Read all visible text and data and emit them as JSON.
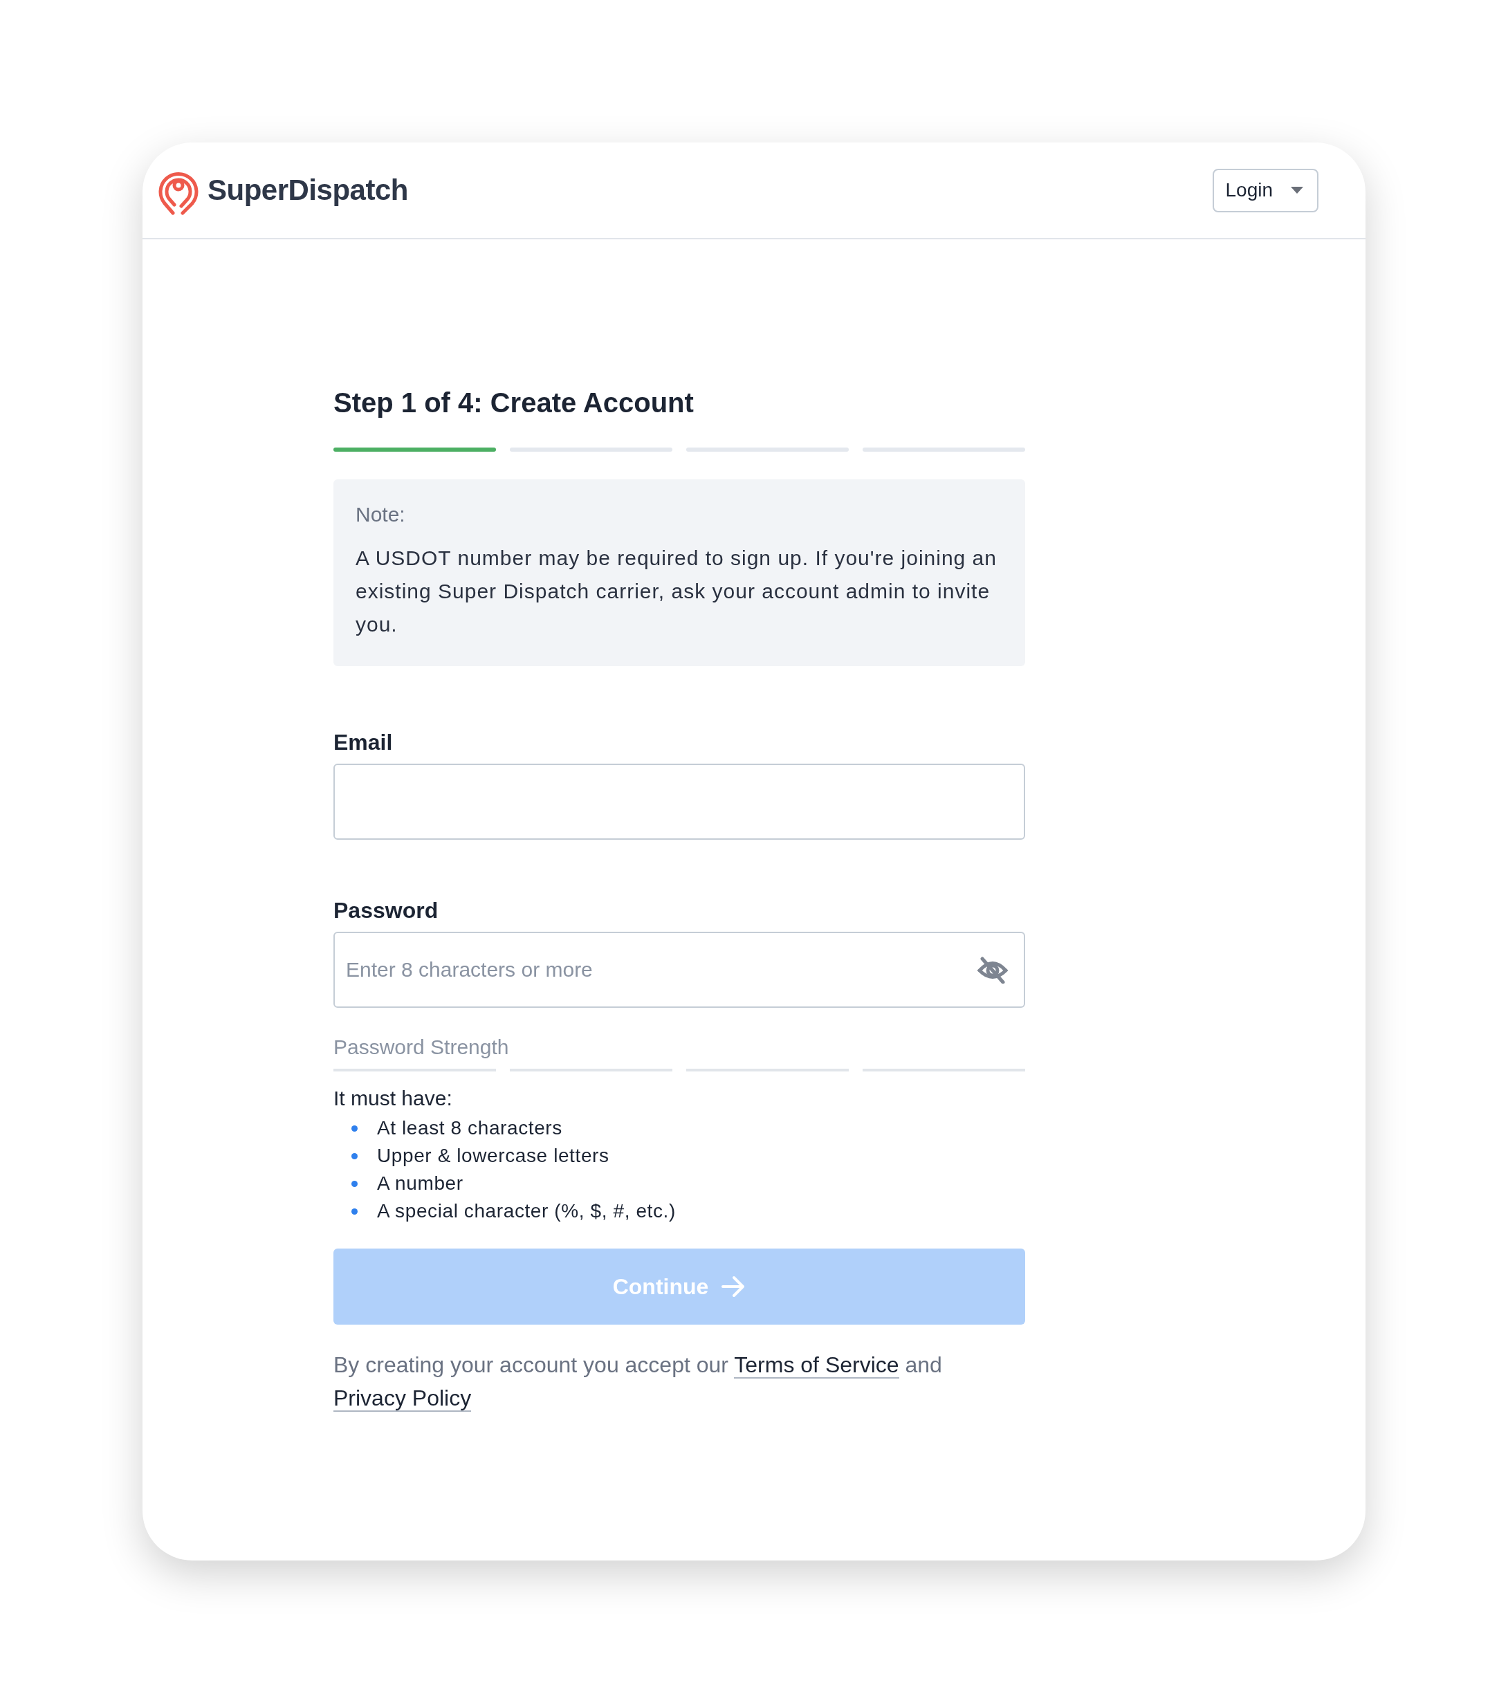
{
  "header": {
    "brand": "SuperDispatch",
    "login_button": "Login"
  },
  "title": "Step 1 of 4: Create Account",
  "steps": [
    {
      "done": true
    },
    {
      "done": false
    },
    {
      "done": false
    },
    {
      "done": false
    }
  ],
  "note": {
    "heading": "Note:",
    "body": "A USDOT number may be required to sign up. If you're joining an existing Super Dispatch carrier, ask your account admin to invite you."
  },
  "email": {
    "label": "Email"
  },
  "password": {
    "label": "Password",
    "placeholder": "Enter 8 characters or more",
    "visible": false
  },
  "strength": {
    "label": "Password Strength"
  },
  "requirements": {
    "heading": "It must have:",
    "items": [
      "At least 8 characters",
      "Upper & lowercase letters",
      "A number",
      "A special character (%, $, #, etc.)"
    ]
  },
  "continue_button": {
    "label": "Continue",
    "disabled": true
  },
  "terms": [
    {
      "kind": "text",
      "text": "By creating your account you accept our "
    },
    {
      "kind": "link",
      "text": "Terms of Service"
    },
    {
      "kind": "text",
      "text": " and "
    },
    {
      "kind": "link",
      "text": "Privacy Policy"
    }
  ]
}
